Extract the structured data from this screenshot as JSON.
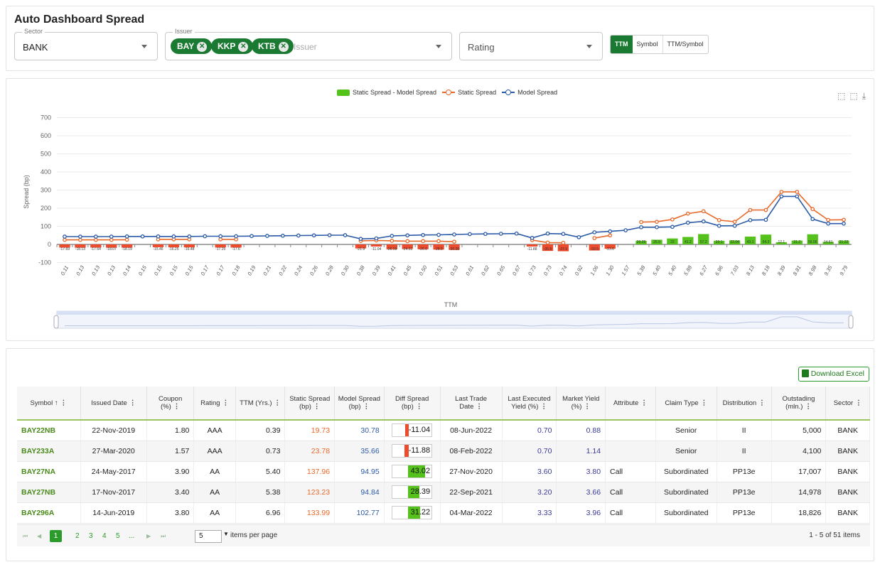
{
  "header": {
    "title": "Auto Dashboard Spread"
  },
  "filters": {
    "sector": {
      "legend": "Sector",
      "value": "BANK"
    },
    "issuer": {
      "legend": "Issuer",
      "chips": [
        "BAY",
        "KKP",
        "KTB"
      ],
      "placeholder": "Issuer"
    },
    "rating": {
      "placeholder": "Rating"
    },
    "view_modes": [
      "TTM",
      "Symbol",
      "TTM/Symbol"
    ],
    "active_mode": "TTM"
  },
  "colors": {
    "accent": "#1a7a32",
    "bar_pos": "#55c21c",
    "bar_neg": "#ee4a2c",
    "static": "#e8692a",
    "model": "#2b5aa8"
  },
  "chart_toolbox_icons": [
    "zoom-icon",
    "zoom-reset-icon",
    "download-image-icon"
  ],
  "chart_data": {
    "type": "line",
    "title": "",
    "xlabel": "TTM",
    "ylabel": "Spread (bp)",
    "ylim": [
      -100,
      700
    ],
    "yticks": [
      -100,
      0,
      100,
      200,
      300,
      400,
      500,
      600,
      700
    ],
    "grid": true,
    "legend_position": "top-center",
    "x": [
      "0.11",
      "0.13",
      "0.13",
      "0.13",
      "0.14",
      "0.15",
      "0.15",
      "0.15",
      "0.15",
      "0.17",
      "0.17",
      "0.18",
      "0.19",
      "0.21",
      "0.22",
      "0.24",
      "0.26",
      "0.28",
      "0.30",
      "0.38",
      "0.39",
      "0.41",
      "0.45",
      "0.50",
      "0.51",
      "0.53",
      "0.61",
      "0.62",
      "0.65",
      "0.67",
      "0.73",
      "0.73",
      "0.74",
      "0.92",
      "1.06",
      "1.30",
      "1.57",
      "5.38",
      "5.40",
      "5.40",
      "5.88",
      "6.27",
      "6.96",
      "7.03",
      "8.13",
      "8.18",
      "8.39",
      "8.81",
      "8.98",
      "9.35",
      "9.79"
    ],
    "series": [
      {
        "name": "Static Spread - Model Spread",
        "kind": "bar",
        "values": [
          -17.69,
          -18.13,
          -17.64,
          -18.07,
          -18.19,
          null,
          -15.46,
          -16.25,
          -16.48,
          null,
          -17.25,
          -17.6,
          null,
          null,
          null,
          null,
          null,
          null,
          null,
          -21.9,
          -11.04,
          -26.59,
          -24.61,
          -26.6,
          -28.5,
          -30.38,
          null,
          null,
          null,
          null,
          -11.88,
          -35.8,
          -37.6,
          null,
          -33.5,
          -23.6,
          null,
          20.25,
          25.9,
          33.0,
          41.2,
          57.2,
          20.1,
          22.04,
          43.1,
          54.3,
          12.1,
          21.2,
          56.06,
          14.61,
          21.22
        ]
      },
      {
        "name": "Static Spread",
        "kind": "line",
        "values": [
          25,
          25,
          25,
          25,
          26,
          null,
          28,
          28,
          28,
          null,
          28,
          28,
          null,
          null,
          null,
          null,
          null,
          null,
          null,
          19.73,
          22,
          20,
          18,
          18,
          18,
          15,
          null,
          null,
          null,
          null,
          23.78,
          10,
          9,
          null,
          35,
          50,
          null,
          123.23,
          125,
          137.96,
          170,
          183,
          133.99,
          125,
          190,
          190,
          290,
          290,
          195,
          135,
          136
        ]
      },
      {
        "name": "Model Spread",
        "kind": "line",
        "values": [
          43,
          43,
          43,
          43,
          44,
          44,
          44,
          44,
          44,
          45,
          45,
          45,
          46,
          47,
          48,
          49,
          50,
          51,
          51,
          30.78,
          33,
          47,
          50,
          52,
          53,
          55,
          57,
          58,
          59,
          60,
          35.66,
          60,
          58,
          40,
          67,
          72,
          78,
          94.84,
          94.95,
          97,
          120,
          127,
          102.77,
          103,
          134,
          136,
          265,
          265,
          140,
          115,
          115
        ]
      }
    ]
  },
  "download_label": "Download Excel",
  "table": {
    "columns": [
      {
        "key": "symbol",
        "label": "Symbol ↑"
      },
      {
        "key": "issued",
        "label": "Issued Date"
      },
      {
        "key": "coupon",
        "label": "Coupon (%)"
      },
      {
        "key": "rating",
        "label": "Rating"
      },
      {
        "key": "ttm",
        "label": "TTM (Yrs.)"
      },
      {
        "key": "static",
        "label": "Static Spread (bp)"
      },
      {
        "key": "model",
        "label": "Model Spread (bp)"
      },
      {
        "key": "diff",
        "label": "Diff Spread (bp)"
      },
      {
        "key": "last_trade",
        "label": "Last Trade Date"
      },
      {
        "key": "last_yield",
        "label": "Last Executed Yield (%)"
      },
      {
        "key": "market_yield",
        "label": "Market Yield (%)"
      },
      {
        "key": "attribute",
        "label": "Attribute"
      },
      {
        "key": "claim",
        "label": "Claim Type"
      },
      {
        "key": "distribution",
        "label": "Distribution"
      },
      {
        "key": "outstanding",
        "label": "Outstading (mln.)"
      },
      {
        "key": "sector",
        "label": "Sector"
      }
    ],
    "rows": [
      {
        "symbol": "BAY22NB",
        "issued": "22-Nov-2019",
        "coupon": "1.80",
        "rating": "AAA",
        "ttm": "0.39",
        "static": "19.73",
        "model": "30.78",
        "diff": "-11.04",
        "last_trade": "08-Jun-2022",
        "last_yield": "0.70",
        "market_yield": "0.88",
        "attribute": "",
        "claim": "Senior",
        "distribution": "II",
        "outstanding": "5,000",
        "sector": "BANK"
      },
      {
        "symbol": "BAY233A",
        "issued": "27-Mar-2020",
        "coupon": "1.57",
        "rating": "AAA",
        "ttm": "0.73",
        "static": "23.78",
        "model": "35.66",
        "diff": "-11.88",
        "last_trade": "08-Feb-2022",
        "last_yield": "0.70",
        "market_yield": "1.14",
        "attribute": "",
        "claim": "Senior",
        "distribution": "II",
        "outstanding": "4,100",
        "sector": "BANK"
      },
      {
        "symbol": "BAY27NA",
        "issued": "24-May-2017",
        "coupon": "3.90",
        "rating": "AA",
        "ttm": "5.40",
        "static": "137.96",
        "model": "94.95",
        "diff": "43.02",
        "last_trade": "27-Nov-2020",
        "last_yield": "3.60",
        "market_yield": "3.80",
        "attribute": "Call",
        "claim": "Subordinated",
        "distribution": "PP13e",
        "outstanding": "17,007",
        "sector": "BANK"
      },
      {
        "symbol": "BAY27NB",
        "issued": "17-Nov-2017",
        "coupon": "3.40",
        "rating": "AA",
        "ttm": "5.38",
        "static": "123.23",
        "model": "94.84",
        "diff": "28.39",
        "last_trade": "22-Sep-2021",
        "last_yield": "3.20",
        "market_yield": "3.66",
        "attribute": "Call",
        "claim": "Subordinated",
        "distribution": "PP13e",
        "outstanding": "14,978",
        "sector": "BANK"
      },
      {
        "symbol": "BAY296A",
        "issued": "14-Jun-2019",
        "coupon": "3.80",
        "rating": "AA",
        "ttm": "6.96",
        "static": "133.99",
        "model": "102.77",
        "diff": "31.22",
        "last_trade": "04-Mar-2022",
        "last_yield": "3.33",
        "market_yield": "3.96",
        "attribute": "Call",
        "claim": "Subordinated",
        "distribution": "PP13e",
        "outstanding": "18,826",
        "sector": "BANK"
      }
    ]
  },
  "pager": {
    "pages": [
      "1",
      "2",
      "3",
      "4",
      "5",
      "..."
    ],
    "current": "1",
    "first_label": "⏮",
    "prev_label": "◀",
    "next_label": "▶",
    "last_label": "⏭",
    "page_size": "5",
    "per_page_label": "items per page",
    "info": "1 - 5 of 51 items"
  }
}
